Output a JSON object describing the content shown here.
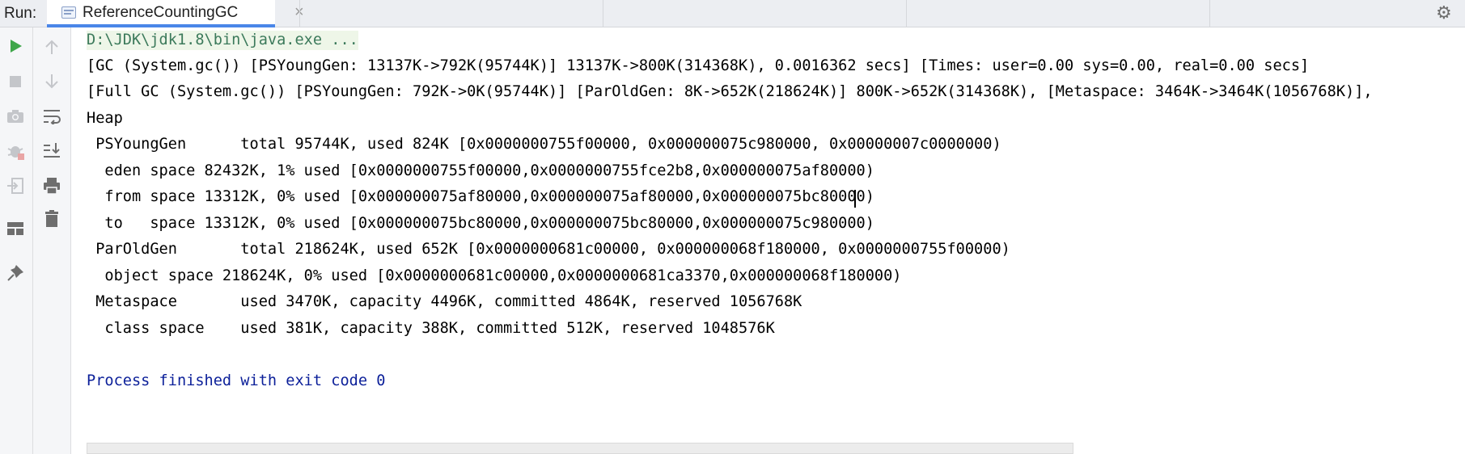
{
  "run_label": "Run:",
  "tab": {
    "title": "ReferenceCountingGC",
    "close": "×"
  },
  "toolbar_icons": {
    "left": [
      "play-icon",
      "stop-icon",
      "camera-icon",
      "bug-icon",
      "exit-icon",
      "layout-icon",
      "pin-icon"
    ],
    "right": [
      "arrow-up-icon",
      "arrow-down-icon",
      "soft-wrap-icon",
      "scroll-to-end-icon",
      "print-icon",
      "trash-icon"
    ]
  },
  "console": {
    "command": "D:\\JDK\\jdk1.8\\bin\\java.exe ...",
    "lines": [
      "[GC (System.gc()) [PSYoungGen: 13137K->792K(95744K)] 13137K->800K(314368K), 0.0016362 secs] [Times: user=0.00 sys=0.00, real=0.00 secs]",
      "[Full GC (System.gc()) [PSYoungGen: 792K->0K(95744K)] [ParOldGen: 8K->652K(218624K)] 800K->652K(314368K), [Metaspace: 3464K->3464K(1056768K)],",
      "Heap",
      " PSYoungGen      total 95744K, used 824K [0x0000000755f00000, 0x000000075c980000, 0x00000007c0000000)",
      "  eden space 82432K, 1% used [0x0000000755f00000,0x0000000755fce2b8,0x000000075af80000)",
      "  from space 13312K, 0% used [0x000000075af80000,0x000000075af80000,0x000000075bc80000)",
      "  to   space 13312K, 0% used [0x000000075bc80000,0x000000075bc80000,0x000000075c980000)",
      " ParOldGen       total 218624K, used 652K [0x0000000681c00000, 0x000000068f180000, 0x0000000755f00000)",
      "  object space 218624K, 0% used [0x0000000681c00000,0x0000000681ca3370,0x000000068f180000)",
      " Metaspace       used 3470K, capacity 4496K, committed 4864K, reserved 1056768K",
      "  class space    used 381K, capacity 388K, committed 512K, reserved 1048576K"
    ],
    "finished": "Process finished with exit code 0"
  },
  "colors": {
    "tab_underline": "#4a86e8",
    "run_green": "#3fa64a",
    "command_text": "#3c7a5b",
    "finished_text": "#0b1f99"
  }
}
